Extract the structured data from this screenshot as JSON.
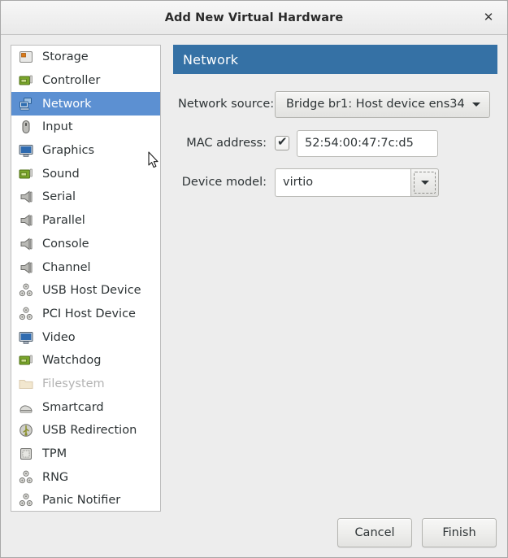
{
  "window": {
    "title": "Add New Virtual Hardware",
    "close_label": "✕"
  },
  "sidebar": {
    "items": [
      {
        "label": "Storage",
        "icon": "storage-icon",
        "selected": false,
        "disabled": false
      },
      {
        "label": "Controller",
        "icon": "controller-icon",
        "selected": false,
        "disabled": false
      },
      {
        "label": "Network",
        "icon": "network-icon",
        "selected": true,
        "disabled": false
      },
      {
        "label": "Input",
        "icon": "input-mouse-icon",
        "selected": false,
        "disabled": false
      },
      {
        "label": "Graphics",
        "icon": "graphics-icon",
        "selected": false,
        "disabled": false
      },
      {
        "label": "Sound",
        "icon": "sound-icon",
        "selected": false,
        "disabled": false
      },
      {
        "label": "Serial",
        "icon": "serial-port-icon",
        "selected": false,
        "disabled": false
      },
      {
        "label": "Parallel",
        "icon": "parallel-port-icon",
        "selected": false,
        "disabled": false
      },
      {
        "label": "Console",
        "icon": "console-port-icon",
        "selected": false,
        "disabled": false
      },
      {
        "label": "Channel",
        "icon": "channel-port-icon",
        "selected": false,
        "disabled": false
      },
      {
        "label": "USB Host Device",
        "icon": "usb-host-gear-icon",
        "selected": false,
        "disabled": false
      },
      {
        "label": "PCI Host Device",
        "icon": "pci-host-gear-icon",
        "selected": false,
        "disabled": false
      },
      {
        "label": "Video",
        "icon": "video-icon",
        "selected": false,
        "disabled": false
      },
      {
        "label": "Watchdog",
        "icon": "watchdog-icon",
        "selected": false,
        "disabled": false
      },
      {
        "label": "Filesystem",
        "icon": "folder-icon",
        "selected": false,
        "disabled": true
      },
      {
        "label": "Smartcard",
        "icon": "smartcard-icon",
        "selected": false,
        "disabled": false
      },
      {
        "label": "USB Redirection",
        "icon": "usb-redirection-icon",
        "selected": false,
        "disabled": false
      },
      {
        "label": "TPM",
        "icon": "tpm-chip-icon",
        "selected": false,
        "disabled": false
      },
      {
        "label": "RNG",
        "icon": "rng-gear-icon",
        "selected": false,
        "disabled": false
      },
      {
        "label": "Panic Notifier",
        "icon": "panic-gear-icon",
        "selected": false,
        "disabled": false
      }
    ]
  },
  "pane": {
    "title": "Network",
    "header_color": "#3571a5",
    "selection_color": "#5c90d2",
    "fields": {
      "network_source": {
        "label": "Network source:",
        "value": "Bridge br1: Host device ens34"
      },
      "mac_address": {
        "label": "MAC address:",
        "checked": true,
        "check_glyph": "✔",
        "value": "52:54:00:47:7c:d5"
      },
      "device_model": {
        "label": "Device model:",
        "value": "virtio"
      }
    }
  },
  "footer": {
    "cancel_label": "Cancel",
    "finish_label": "Finish"
  }
}
